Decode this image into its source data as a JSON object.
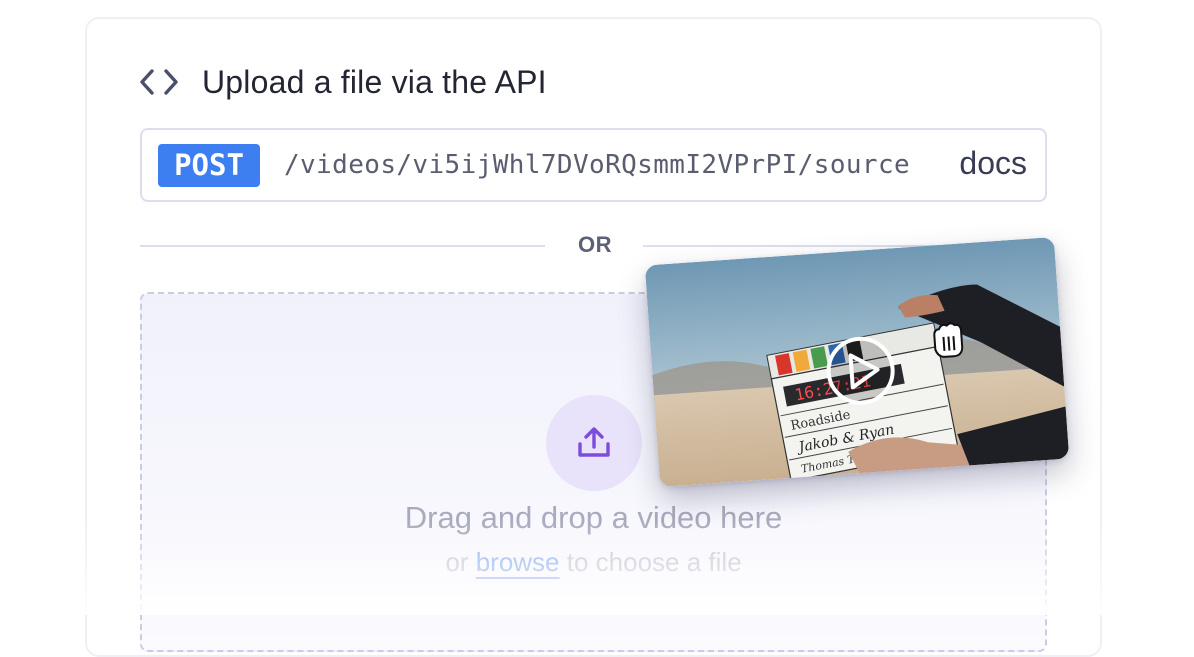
{
  "header": {
    "icon": "code-brackets-icon",
    "title": "Upload a file via the API"
  },
  "endpoint": {
    "method": "POST",
    "path": "/videos/vi5ijWhl7DVoRQsmmI2VPrPI/source",
    "docs_label": "docs",
    "method_color": "#3d7ef0"
  },
  "divider": {
    "label": "OR"
  },
  "dropzone": {
    "icon": "upload-icon",
    "headline": "Drag and drop a video here",
    "sub_prefix": "or",
    "browse_label": "browse",
    "sub_suffix": "to choose a file"
  },
  "video_preview": {
    "play_icon": "play-icon",
    "cursor_icon": "grab-hand-icon",
    "clapper": {
      "time": "16:27:21",
      "line1": "Roadside",
      "line2": "Jakob & Ryan",
      "line3": "Thomas Taugher"
    }
  },
  "colors": {
    "accent": "#7c4ddb",
    "link": "#8fb0ef"
  }
}
